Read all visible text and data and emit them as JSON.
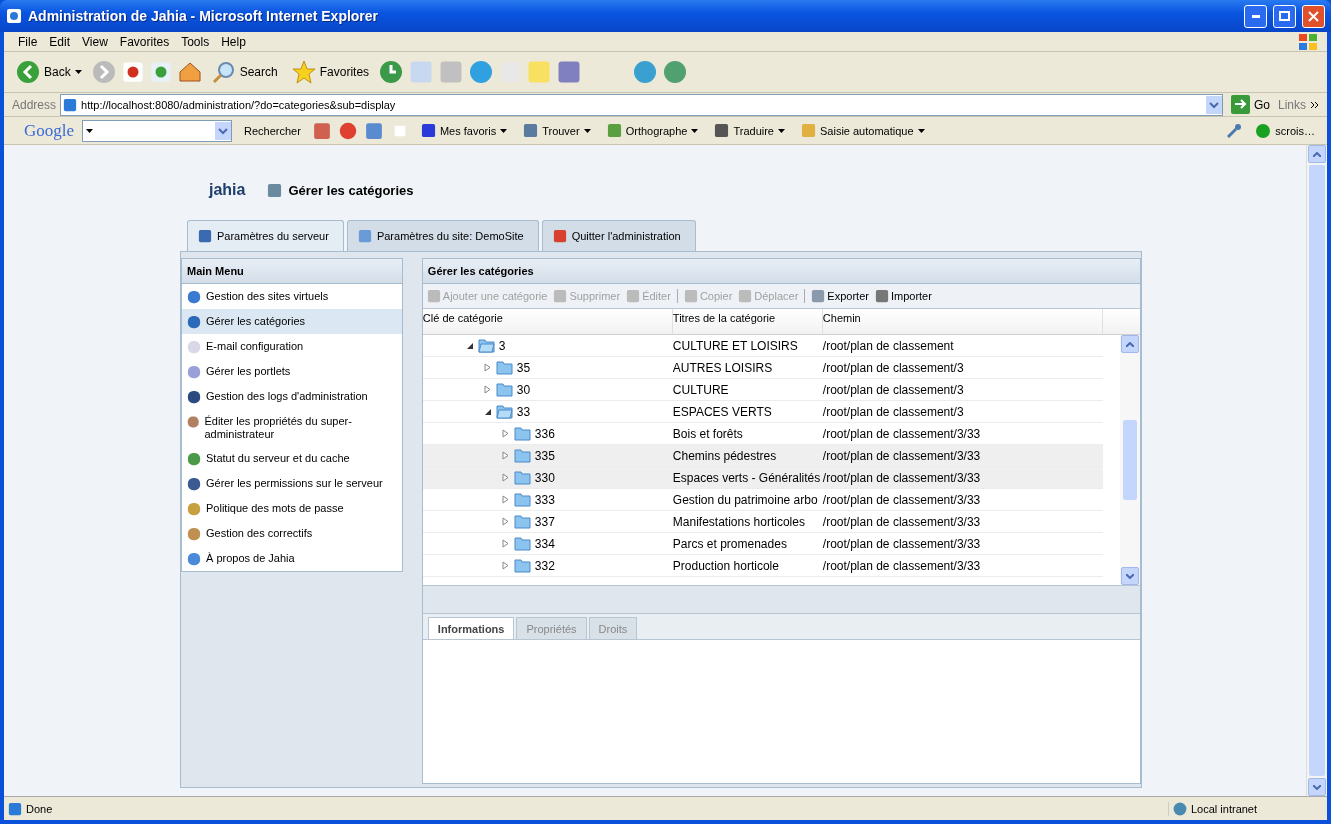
{
  "window": {
    "title": "Administration de Jahia - Microsoft Internet Explorer"
  },
  "menu_bar": [
    "File",
    "Edit",
    "View",
    "Favorites",
    "Tools",
    "Help"
  ],
  "toolbar": {
    "back": "Back",
    "search": "Search",
    "favorites": "Favorites"
  },
  "address_bar": {
    "label": "Address",
    "url": "http://localhost:8080/administration/?do=categories&sub=display",
    "go": "Go",
    "links": "Links"
  },
  "google_bar": {
    "logo": "Google",
    "search_button": "Rechercher",
    "items": [
      "Mes favoris",
      "Trouver",
      "Orthographe",
      "Traduire",
      "Saisie automatique"
    ],
    "account": "scrois…"
  },
  "page": {
    "logo": "jahia",
    "title": "Gérer les catégories",
    "tabs": [
      {
        "label": "Paramètres du serveur",
        "selected": true
      },
      {
        "label": "Paramètres du site: DemoSite",
        "selected": false
      },
      {
        "label": "Quitter l'administration",
        "selected": false
      }
    ],
    "sidebar": {
      "title": "Main Menu",
      "items": [
        {
          "label": "Gestion des sites virtuels",
          "selected": false
        },
        {
          "label": "Gérer les catégories",
          "selected": true
        },
        {
          "label": "E-mail configuration",
          "selected": false
        },
        {
          "label": "Gérer les portlets",
          "selected": false
        },
        {
          "label": "Gestion des logs d'administration",
          "selected": false
        },
        {
          "label": "Éditer les propriétés du super-administrateur",
          "selected": false
        },
        {
          "label": "Statut du serveur et du cache",
          "selected": false
        },
        {
          "label": "Gérer les permissions sur le serveur",
          "selected": false
        },
        {
          "label": "Politique des mots de passe",
          "selected": false
        },
        {
          "label": "Gestion des correctifs",
          "selected": false
        },
        {
          "label": "À propos de Jahia",
          "selected": false
        }
      ]
    },
    "panel": {
      "title": "Gérer les catégories",
      "toolbar_groups": [
        [
          {
            "label": "Ajouter une catégorie",
            "disabled": true
          },
          {
            "label": "Supprimer",
            "disabled": true
          },
          {
            "label": "Éditer",
            "disabled": true
          }
        ],
        [
          {
            "label": "Copier",
            "disabled": true
          },
          {
            "label": "Déplacer",
            "disabled": true
          }
        ],
        [
          {
            "label": "Exporter",
            "disabled": false
          },
          {
            "label": "Importer",
            "disabled": false
          }
        ]
      ],
      "columns": [
        "Clé de catégorie",
        "Titres de la catégorie",
        "Chemin"
      ],
      "tree": [
        {
          "key": "3",
          "title": "CULTURE ET LOISIRS",
          "path": "/root/plan de classement",
          "expanded": true,
          "selected": false,
          "children": [
            {
              "key": "35",
              "title": "AUTRES LOISIRS",
              "path": "/root/plan de classement/3",
              "expanded": false,
              "selected": false
            },
            {
              "key": "30",
              "title": "CULTURE",
              "path": "/root/plan de classement/3",
              "expanded": false,
              "selected": false
            },
            {
              "key": "33",
              "title": "ESPACES VERTS",
              "path": "/root/plan de classement/3",
              "expanded": true,
              "selected": false,
              "children": [
                {
                  "key": "336",
                  "title": "Bois et forêts",
                  "path": "/root/plan de classement/3/33",
                  "expanded": false,
                  "selected": false
                },
                {
                  "key": "335",
                  "title": "Chemins pédestres",
                  "path": "/root/plan de classement/3/33",
                  "expanded": false,
                  "selected": true
                },
                {
                  "key": "330",
                  "title": "Espaces verts - Généralités",
                  "path": "/root/plan de classement/3/33",
                  "expanded": false,
                  "selected": true
                },
                {
                  "key": "333",
                  "title": "Gestion du patrimoine arbo",
                  "path": "/root/plan de classement/3/33",
                  "expanded": false,
                  "selected": false
                },
                {
                  "key": "337",
                  "title": "Manifestations horticoles",
                  "path": "/root/plan de classement/3/33",
                  "expanded": false,
                  "selected": false
                },
                {
                  "key": "334",
                  "title": "Parcs et promenades",
                  "path": "/root/plan de classement/3/33",
                  "expanded": false,
                  "selected": false
                },
                {
                  "key": "332",
                  "title": "Production horticole",
                  "path": "/root/plan de classement/3/33",
                  "expanded": false,
                  "selected": false
                }
              ]
            }
          ]
        }
      ],
      "detail_tabs": [
        {
          "label": "Informations",
          "selected": true
        },
        {
          "label": "Propriétés",
          "selected": false
        },
        {
          "label": "Droits",
          "selected": false
        }
      ]
    }
  },
  "status_bar": {
    "text": "Done",
    "zone": "Local intranet"
  }
}
